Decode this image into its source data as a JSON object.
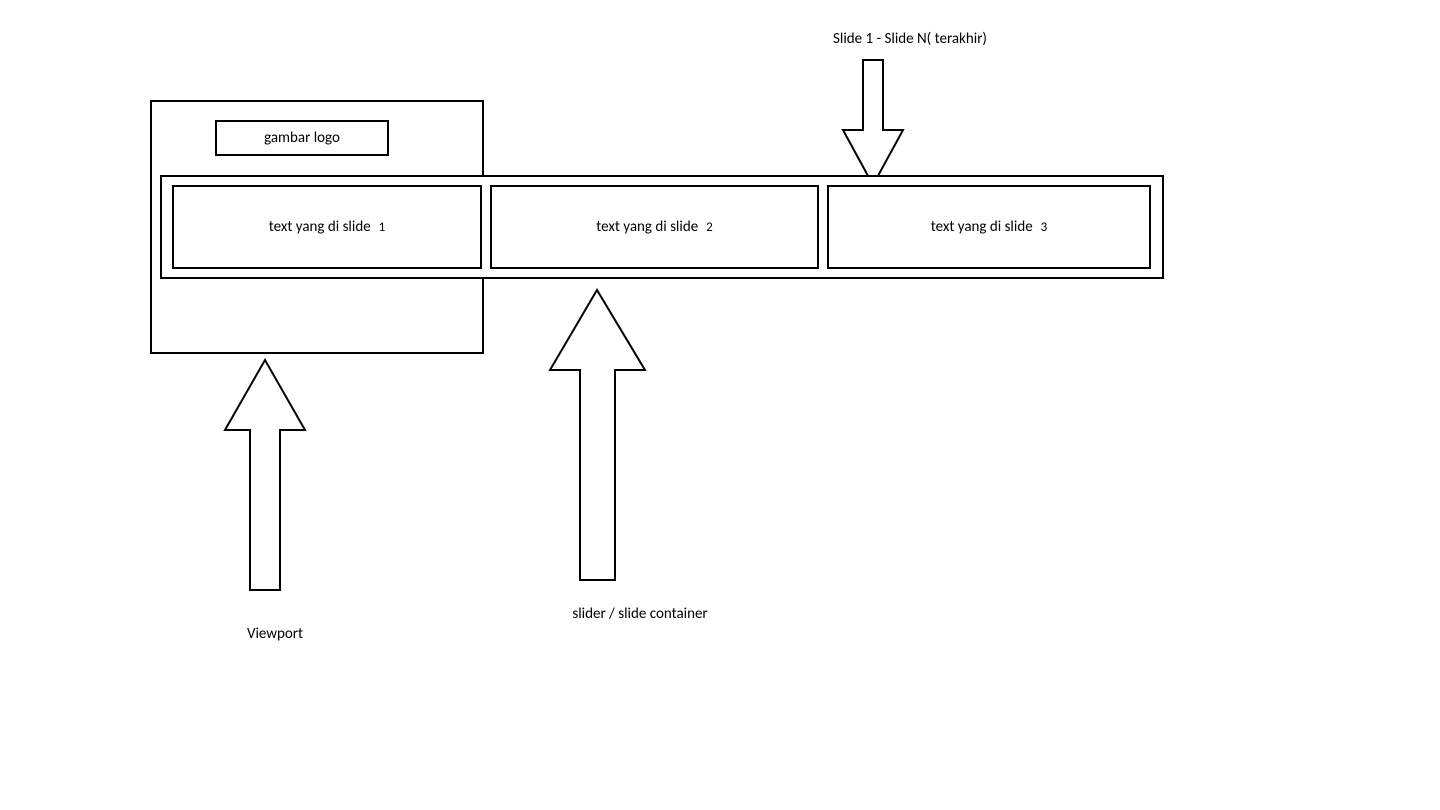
{
  "annotations": {
    "slides_range": "Slide 1 - Slide N( terakhir)",
    "viewport": "Viewport",
    "slider_container": "slider / slide container"
  },
  "logo_label": "gambar logo",
  "slides": [
    {
      "text": "text yang di slide",
      "num": "1"
    },
    {
      "text": "text yang di slide",
      "num": "2"
    },
    {
      "text": "text yang di slide",
      "num": "3"
    }
  ]
}
